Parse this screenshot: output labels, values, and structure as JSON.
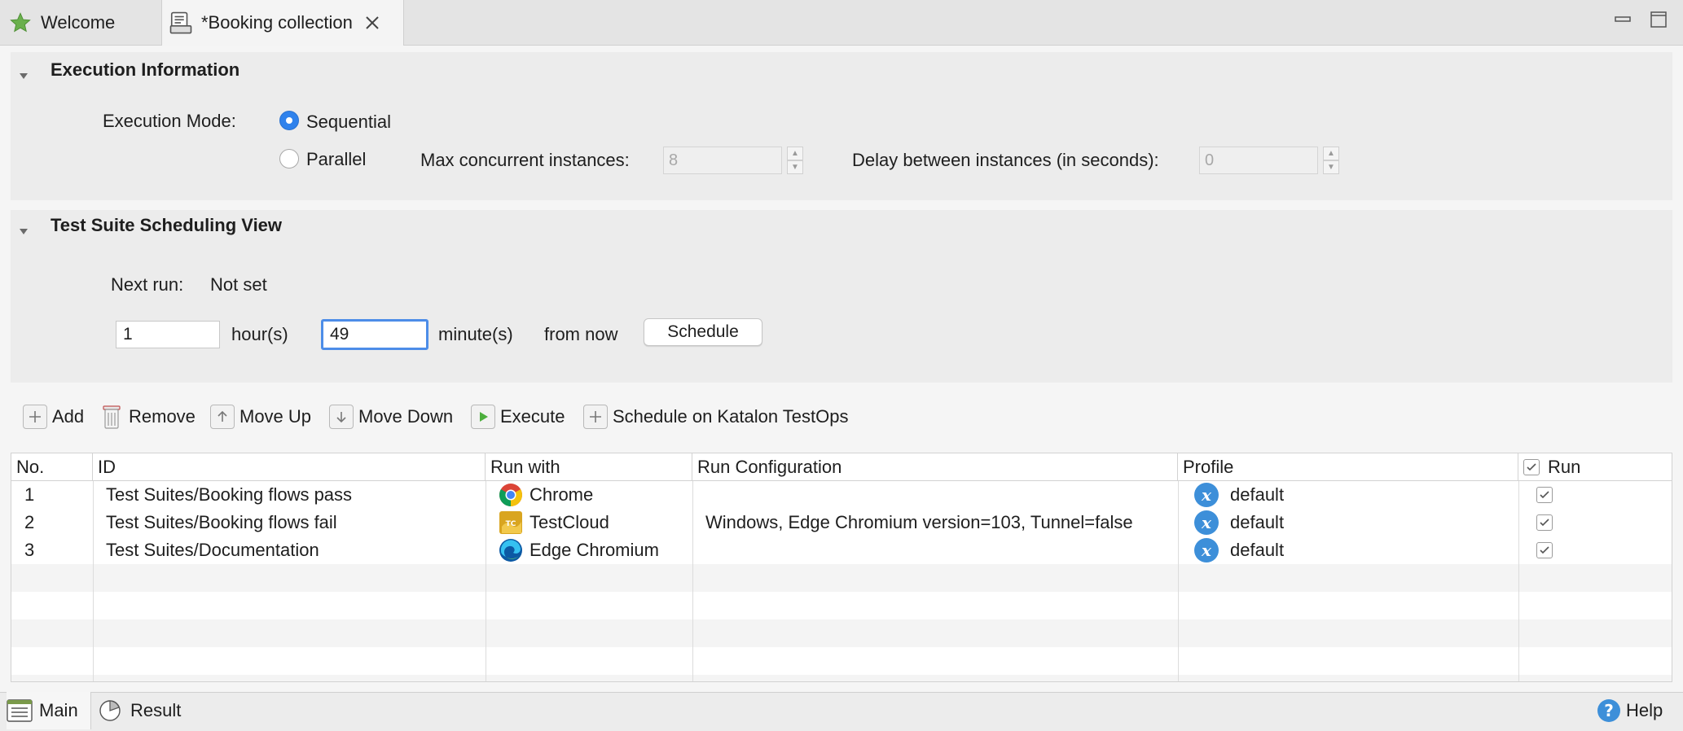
{
  "tabs": {
    "welcome_label": "Welcome",
    "active_label": "*Booking collection"
  },
  "execution": {
    "title": "Execution Information",
    "mode_label": "Execution Mode:",
    "sequential_label": "Sequential",
    "parallel_label": "Parallel",
    "selected_mode": "Sequential",
    "max_label": "Max concurrent instances:",
    "max_value": "8",
    "delay_label": "Delay between instances (in seconds):",
    "delay_value": "0"
  },
  "scheduling": {
    "title": "Test Suite Scheduling View",
    "next_run_label": "Next run:",
    "next_run_value": "Not set",
    "hours_value": "1",
    "hours_label": "hour(s)",
    "minutes_value": "49",
    "minutes_label": "minute(s)",
    "from_now_label": "from now",
    "schedule_button": "Schedule"
  },
  "toolbar": {
    "add": "Add",
    "remove": "Remove",
    "move_up": "Move Up",
    "move_down": "Move Down",
    "execute": "Execute",
    "schedule_testops": "Schedule on Katalon TestOps"
  },
  "table": {
    "headers": {
      "no": "No.",
      "id": "ID",
      "run_with": "Run with",
      "run_config": "Run Configuration",
      "profile": "Profile",
      "run": "Run"
    },
    "rows": [
      {
        "no": "1",
        "id": "Test Suites/Booking flows pass",
        "run_with": "Chrome",
        "run_with_icon": "chrome-icon",
        "run_config": "",
        "profile": "default",
        "run": true
      },
      {
        "no": "2",
        "id": "Test Suites/Booking flows fail",
        "run_with": "TestCloud",
        "run_with_icon": "testcloud-icon",
        "run_config": "Windows, Edge Chromium version=103, Tunnel=false",
        "profile": "default",
        "run": true
      },
      {
        "no": "3",
        "id": "Test Suites/Documentation",
        "run_with": "Edge Chromium",
        "run_with_icon": "edge-icon",
        "run_config": "",
        "profile": "default",
        "run": true
      }
    ]
  },
  "bottom_tabs": {
    "main": "Main",
    "result": "Result",
    "help": "Help"
  },
  "colors": {
    "accent": "#2f82ec",
    "profile_badge": "#3d8fd9",
    "execute_green": "#4cae3c"
  }
}
